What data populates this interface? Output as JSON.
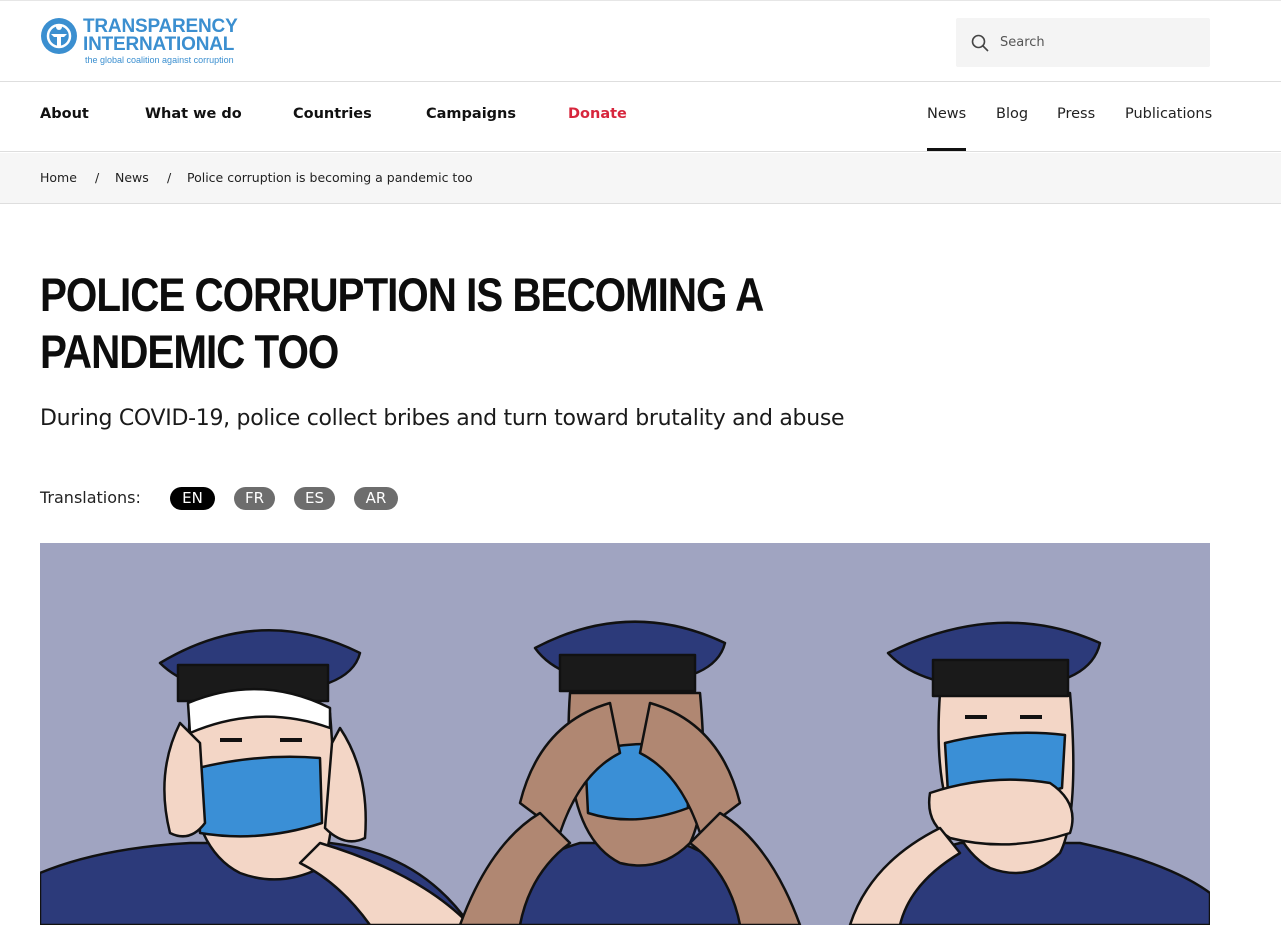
{
  "header": {
    "logo": {
      "line1": "TRANSPARENCY",
      "line2": "INTERNATIONAL",
      "tagline": "the global coalition against corruption"
    },
    "search": {
      "placeholder": "Search",
      "value": ""
    }
  },
  "nav": {
    "primary": [
      "About",
      "What we do",
      "Countries",
      "Campaigns",
      "Donate"
    ],
    "secondary": [
      "News",
      "Blog",
      "Press",
      "Publications"
    ],
    "active": "News"
  },
  "breadcrumb": [
    "Home",
    "News",
    "Police corruption is becoming a pandemic too"
  ],
  "article": {
    "title": "POLICE CORRUPTION IS BECOMING A PANDEMIC TOO",
    "subtitle": "During COVID-19, police collect bribes and turn toward brutality and abuse",
    "translations_label": "Translations:",
    "translations": [
      "EN",
      "FR",
      "ES",
      "AR"
    ],
    "active_translation": "EN"
  },
  "hero": {
    "colors": {
      "background": "#a0a4c1",
      "uniform": "#2c3a7a",
      "mask": "#3a8fd6",
      "skin_light": "#f3d6c6",
      "skin_dark": "#b08772"
    }
  },
  "colors": {
    "brand": "#3b8fd0",
    "donate": "#d7263d"
  }
}
